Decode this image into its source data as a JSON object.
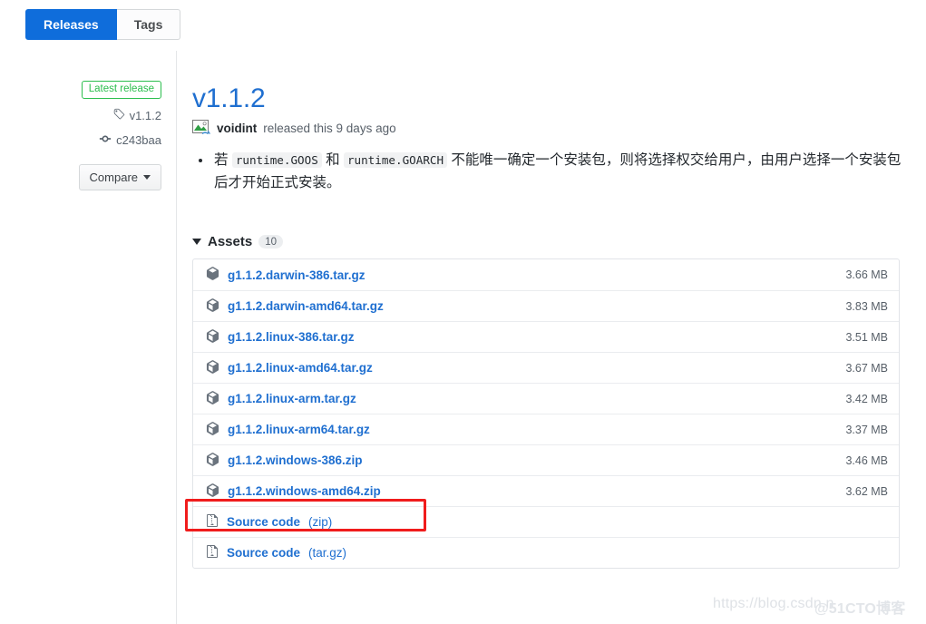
{
  "tabs": [
    {
      "label": "Releases",
      "active": true
    },
    {
      "label": "Tags",
      "active": false
    }
  ],
  "sidebar": {
    "latest_badge": "Latest release",
    "tag_icon": "tag-icon",
    "tag_name": "v1.1.2",
    "commit_icon": "git-commit-icon",
    "commit_hash": "c243baa",
    "compare_label": "Compare"
  },
  "release": {
    "title": "v1.1.2",
    "avatar_icon": "broken-image-avatar-icon",
    "author": "voidint",
    "byline_text": "released this 9 days ago",
    "notes": {
      "prefix": "若 ",
      "code1": "runtime.GOOS",
      "mid": " 和 ",
      "code2": "runtime.GOARCH",
      "suffix": " 不能唯一确定一个安装包，则将选择权交给用户，由用户选择一个安装包后才开始正式安装。"
    }
  },
  "assets": {
    "label": "Assets",
    "count": "10",
    "collapse_icon": "triangle-down-icon",
    "rows": [
      {
        "icon": "package-icon",
        "name": "g1.1.2.darwin-386.tar.gz",
        "fmt": "",
        "size": "3.66 MB",
        "highlighted": false
      },
      {
        "icon": "package-icon",
        "name": "g1.1.2.darwin-amd64.tar.gz",
        "fmt": "",
        "size": "3.83 MB",
        "highlighted": false
      },
      {
        "icon": "package-icon",
        "name": "g1.1.2.linux-386.tar.gz",
        "fmt": "",
        "size": "3.51 MB",
        "highlighted": false
      },
      {
        "icon": "package-icon",
        "name": "g1.1.2.linux-amd64.tar.gz",
        "fmt": "",
        "size": "3.67 MB",
        "highlighted": false
      },
      {
        "icon": "package-icon",
        "name": "g1.1.2.linux-arm.tar.gz",
        "fmt": "",
        "size": "3.42 MB",
        "highlighted": false
      },
      {
        "icon": "package-icon",
        "name": "g1.1.2.linux-arm64.tar.gz",
        "fmt": "",
        "size": "3.37 MB",
        "highlighted": false
      },
      {
        "icon": "package-icon",
        "name": "g1.1.2.windows-386.zip",
        "fmt": "",
        "size": "3.46 MB",
        "highlighted": false
      },
      {
        "icon": "package-icon",
        "name": "g1.1.2.windows-amd64.zip",
        "fmt": "",
        "size": "3.62 MB",
        "highlighted": true
      },
      {
        "icon": "file-zip-icon",
        "name": "Source code",
        "fmt": " (zip)",
        "size": "",
        "highlighted": false
      },
      {
        "icon": "file-zip-icon",
        "name": "Source code",
        "fmt": " (tar.gz)",
        "size": "",
        "highlighted": false
      }
    ]
  },
  "annotation": {
    "name": "red-highlight-box",
    "color": "#f01c1c"
  },
  "watermark": {
    "text1": "https://blog.csdn.n",
    "text2": "@51CTO博客"
  },
  "colors": {
    "accent_blue": "#0f6ddb",
    "link_blue": "#1f6fd0",
    "green": "#2cbe4e",
    "muted": "#586069",
    "border": "#e1e4e8"
  }
}
